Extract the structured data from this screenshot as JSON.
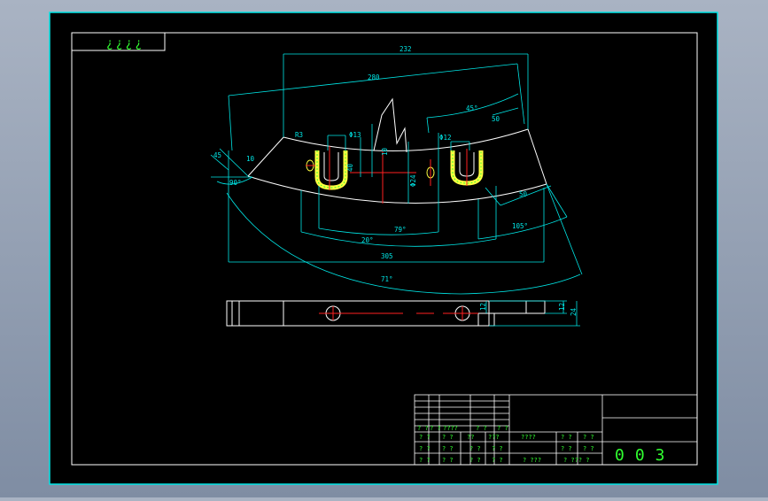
{
  "title_note": "¿¿¿¿",
  "dimensions": {
    "d232": "232",
    "d280": "280",
    "a45": "45°",
    "d50a": "50",
    "d50b": "50",
    "r3": "R3",
    "phi13": "Φ13",
    "phi12": "Φ12",
    "d10v": "10",
    "d40": "40",
    "d24": "Φ24",
    "d305": "305",
    "d20": "20°",
    "d79": "79°",
    "d105": "105°",
    "d71": "71°",
    "d45s": "45",
    "d10s": "10",
    "a90": "90°",
    "h12": "12",
    "h24": "24",
    "h12r": "12"
  },
  "title_block": {
    "row1": [
      "? ?",
      "? ?",
      "????",
      "? ?",
      "? ?"
    ],
    "row2": [
      "? ?",
      "? ?",
      "??",
      "???",
      "????",
      "? ?",
      "? ?"
    ],
    "row3": [
      "? ?",
      "? ?",
      "? ?",
      "? ?",
      "? ?",
      "? ?"
    ],
    "row4": [
      "? ?",
      "? ?",
      "? ?",
      "? ?",
      "? ???",
      "? ??? ?"
    ],
    "drawing_number": "003"
  },
  "colors": {
    "cyan": "#00e6e6",
    "white": "#ffffff",
    "red": "#ff2020",
    "yellow": "#ffff40",
    "green": "#30ff30"
  }
}
